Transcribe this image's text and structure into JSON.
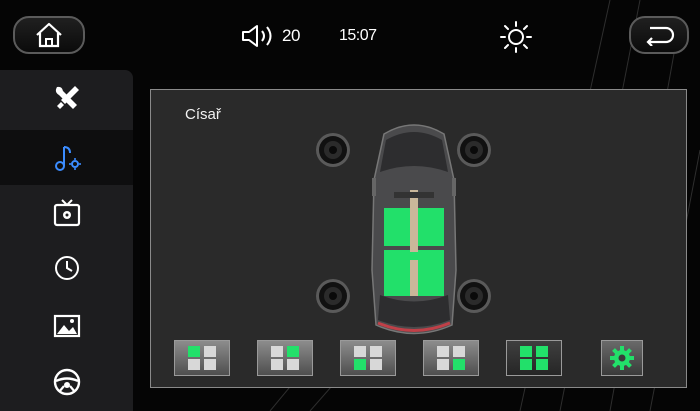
{
  "status_bar": {
    "volume": "20",
    "time": "15:07"
  },
  "sidebar": {
    "items": [
      {
        "name": "tools",
        "icon": "tools-icon"
      },
      {
        "name": "sound",
        "icon": "music-settings-icon",
        "active": true
      },
      {
        "name": "tv",
        "icon": "tv-settings-icon"
      },
      {
        "name": "time",
        "icon": "clock-icon"
      },
      {
        "name": "pictures",
        "icon": "picture-icon"
      },
      {
        "name": "steering",
        "icon": "steering-wheel-icon"
      }
    ]
  },
  "panel": {
    "car_name": "Císař"
  },
  "colors": {
    "accent_green": "#22e06a",
    "accent_blue": "#3b8cff",
    "panel_bg": "#2a2a2a"
  }
}
